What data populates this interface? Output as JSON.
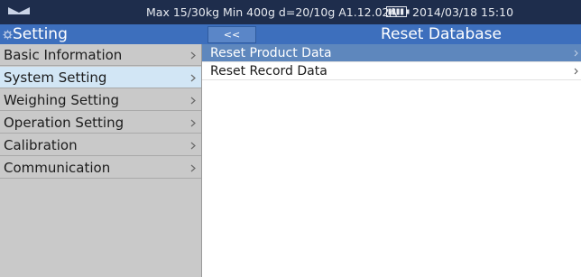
{
  "status_bar": {
    "info": "Max 15/30kg  Min 400g  d=20/10g   A1.12.02A",
    "datetime": "2014/03/18  15:10",
    "icons": [
      "scale-logo-icon",
      "battery-icon"
    ]
  },
  "left_panel": {
    "title": "Setting",
    "icon": "gear-icon",
    "items": [
      {
        "label": "Basic Information",
        "selected": false
      },
      {
        "label": "System Setting",
        "selected": true
      },
      {
        "label": "Weighing Setting",
        "selected": false
      },
      {
        "label": "Operation Setting",
        "selected": false
      },
      {
        "label": "Calibration",
        "selected": false
      },
      {
        "label": "Communication",
        "selected": false
      }
    ]
  },
  "right_panel": {
    "back_label": "<<",
    "title": "Reset Database",
    "items": [
      {
        "label": "Reset Product Data",
        "selected": true
      },
      {
        "label": "Reset Record Data",
        "selected": false
      }
    ]
  },
  "colors": {
    "status_bar_bg": "#1e2d4c",
    "header_bg": "#3d6fbd",
    "sidebar_bg": "#c9c9c9",
    "sidebar_selected_bg": "#d2e6f5",
    "row_selected_bg": "#5e87bd"
  }
}
